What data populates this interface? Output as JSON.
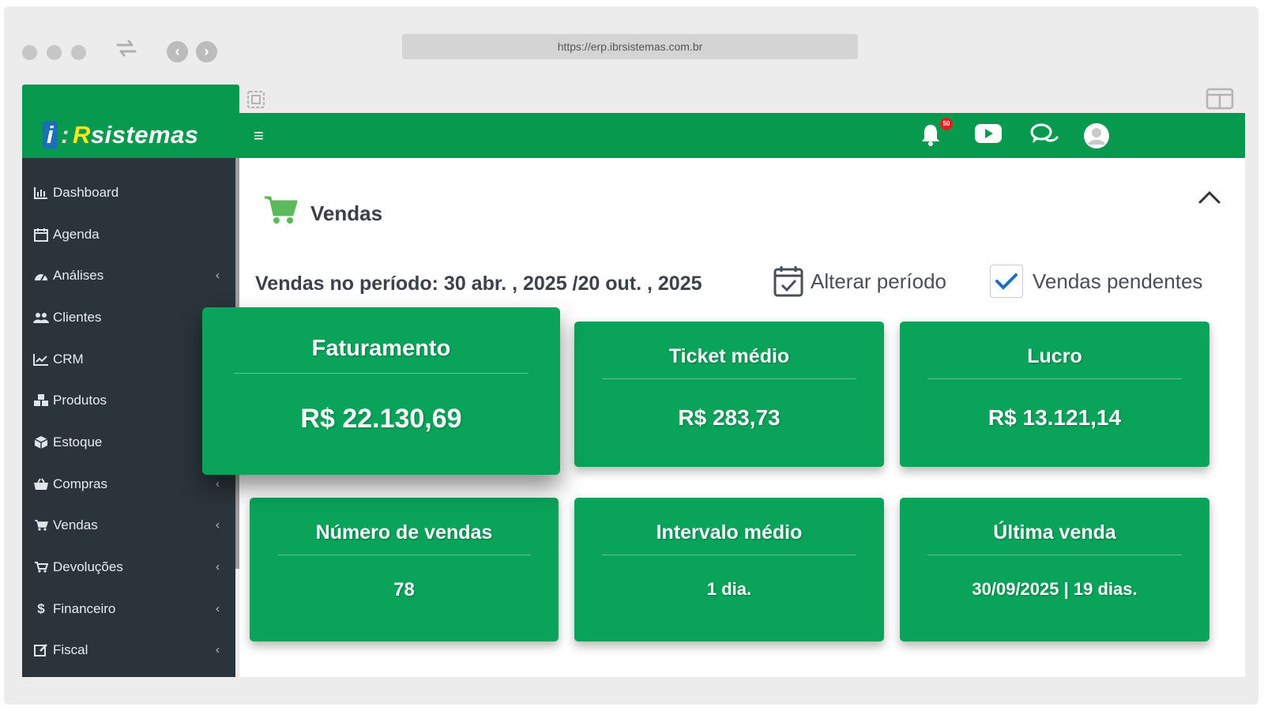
{
  "browser": {
    "url": "https://erp.ibrsistemas.com.br"
  },
  "logo": {
    "i": "i",
    "sep": ":",
    "r": "R",
    "rest": "sistemas"
  },
  "topbar": {
    "notification_count": "50"
  },
  "sidebar": {
    "items": [
      {
        "label": "Dashboard"
      },
      {
        "label": "Agenda"
      },
      {
        "label": "Análises",
        "chevron": "‹"
      },
      {
        "label": "Clientes"
      },
      {
        "label": "CRM"
      },
      {
        "label": "Produtos"
      },
      {
        "label": "Estoque"
      },
      {
        "label": "Compras",
        "chevron": "‹"
      },
      {
        "label": "Vendas",
        "chevron": "‹"
      },
      {
        "label": "Devoluções",
        "chevron": "‹"
      },
      {
        "label": "Financeiro",
        "chevron": "‹"
      },
      {
        "label": "Fiscal",
        "chevron": "‹"
      }
    ]
  },
  "main": {
    "title": "Vendas",
    "period_text": "Vendas no período: 30 abr. , 2025 /20 out. , 2025",
    "alter_period": "Alterar período",
    "pending_sales": "Vendas pendentes",
    "cards": [
      {
        "title": "Faturamento",
        "value": "R$ 22.130,69"
      },
      {
        "title": "Ticket médio",
        "value": "R$ 283,73"
      },
      {
        "title": "Lucro",
        "value": "R$ 13.121,14"
      },
      {
        "title": "Número de vendas",
        "value": "78"
      },
      {
        "title": "Intervalo médio",
        "value": "1 dia."
      },
      {
        "title": "Última venda",
        "value": "30/09/2025 | 19 dias."
      }
    ]
  },
  "colors": {
    "brand_green": "#079a4f",
    "card_green": "#0aa35a",
    "sidebar": "#2b343b"
  }
}
